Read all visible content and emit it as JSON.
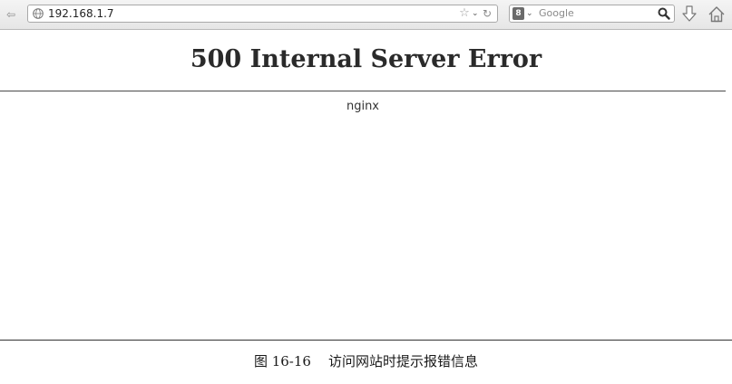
{
  "browser": {
    "url": "192.168.1.7",
    "search_placeholder": "Google",
    "search_engine_glyph": "8",
    "icons": [
      "back-icon",
      "globe-icon",
      "bookmark-star-icon",
      "history-dropdown-icon",
      "reload-icon",
      "search-engine-icon",
      "search-icon",
      "download-icon",
      "home-icon"
    ]
  },
  "page": {
    "title": "500 Internal Server Error",
    "server": "nginx"
  },
  "caption": "图 16-16    访问网站时提示报错信息"
}
